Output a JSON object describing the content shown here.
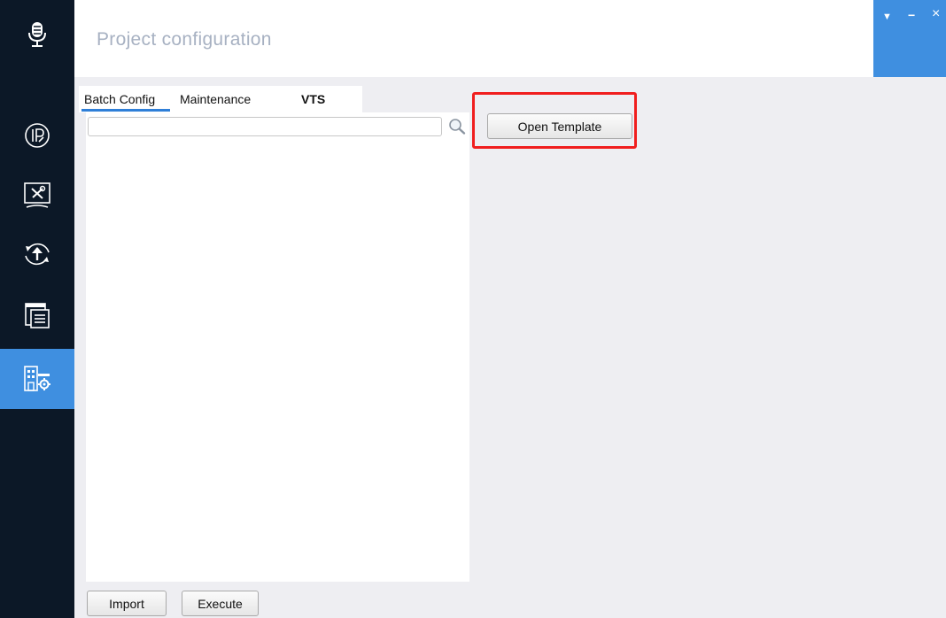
{
  "header": {
    "title": "Project configuration"
  },
  "window_controls": {
    "menu": "▼",
    "minimize": "−",
    "close": "×"
  },
  "tabs": [
    {
      "label": "Batch Config",
      "active": true
    },
    {
      "label": "Maintenance",
      "active": false
    },
    {
      "label": "VTS",
      "active": false
    }
  ],
  "search": {
    "value": "",
    "placeholder": ""
  },
  "buttons": {
    "open_template": "Open Template",
    "import": "Import",
    "execute": "Execute"
  },
  "sidebar": {
    "logo_icon": "microphone-icon",
    "items": [
      {
        "icon": "ip-icon",
        "active": false
      },
      {
        "icon": "tools-monitor-icon",
        "active": false
      },
      {
        "icon": "upload-refresh-icon",
        "active": false
      },
      {
        "icon": "window-list-icon",
        "active": false
      },
      {
        "icon": "building-gear-icon",
        "active": true
      }
    ]
  },
  "colors": {
    "sidebar_bg": "#0c1827",
    "accent": "#3f8fe0",
    "content_bg": "#eeeef2",
    "highlight": "#f01e1e"
  }
}
